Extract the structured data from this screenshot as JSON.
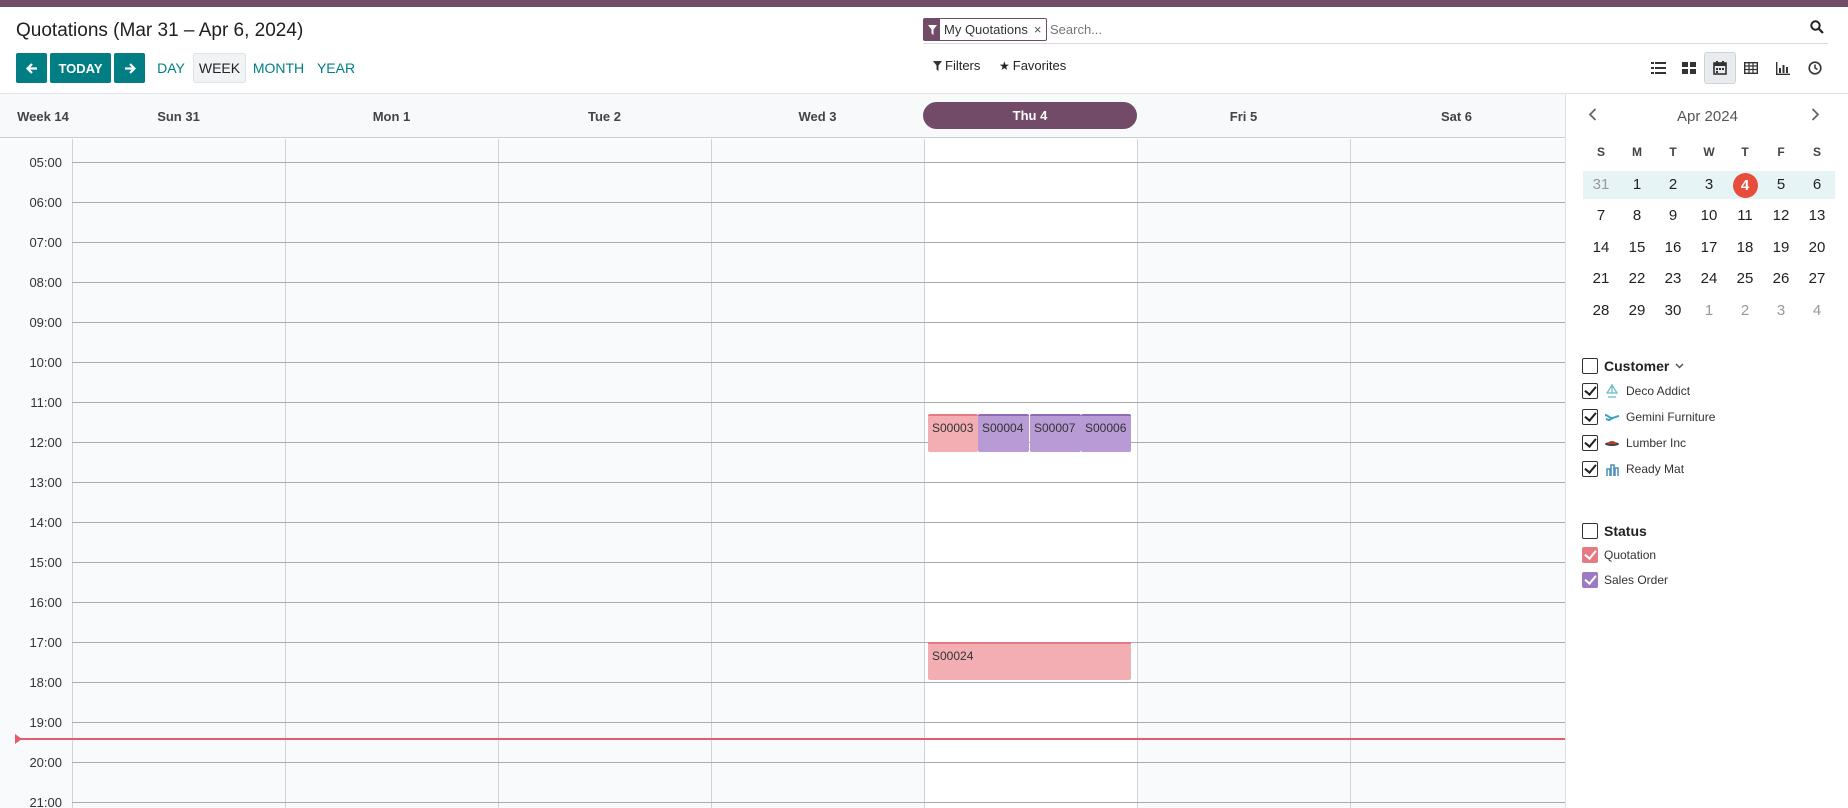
{
  "title": "Quotations (Mar 31 – Apr 6, 2024)",
  "search": {
    "facet_label": "My Quotations",
    "placeholder": "Search..."
  },
  "toolbar": {
    "prev": "←",
    "today": "TODAY",
    "next": "→",
    "scales": [
      "DAY",
      "WEEK",
      "MONTH",
      "YEAR"
    ],
    "active_scale": "WEEK",
    "filters": "Filters",
    "favorites": "Favorites"
  },
  "calendar": {
    "week_label": "Week 14",
    "days": [
      "Sun 31",
      "Mon 1",
      "Tue 2",
      "Wed 3",
      "Thu 4",
      "Fri 5",
      "Sat 6"
    ],
    "today_index": 4,
    "hours": [
      "05:00",
      "06:00",
      "07:00",
      "08:00",
      "09:00",
      "10:00",
      "11:00",
      "12:00",
      "13:00",
      "14:00",
      "15:00",
      "16:00",
      "17:00",
      "18:00",
      "19:00",
      "20:00",
      "21:00"
    ],
    "events": [
      {
        "name": "S00003",
        "status": "quotation"
      },
      {
        "name": "S00004",
        "status": "sales_order"
      },
      {
        "name": "S00007",
        "status": "sales_order"
      },
      {
        "name": "S00006",
        "status": "sales_order"
      },
      {
        "name": "S00024",
        "status": "quotation"
      }
    ]
  },
  "mini_calendar": {
    "title": "Apr 2024",
    "weekdays": [
      "S",
      "M",
      "T",
      "W",
      "T",
      "F",
      "S"
    ],
    "weeks": [
      [
        "31",
        "1",
        "2",
        "3",
        "4",
        "5",
        "6"
      ],
      [
        "7",
        "8",
        "9",
        "10",
        "11",
        "12",
        "13"
      ],
      [
        "14",
        "15",
        "16",
        "17",
        "18",
        "19",
        "20"
      ],
      [
        "21",
        "22",
        "23",
        "24",
        "25",
        "26",
        "27"
      ],
      [
        "28",
        "29",
        "30",
        "1",
        "2",
        "3",
        "4"
      ]
    ],
    "today": "4"
  },
  "filters_panel": {
    "customer": {
      "label": "Customer",
      "items": [
        "Deco Addict",
        "Gemini Furniture",
        "Lumber Inc",
        "Ready Mat"
      ]
    },
    "status": {
      "label": "Status",
      "items": [
        "Quotation",
        "Sales Order"
      ]
    }
  },
  "colors": {
    "brand": "#714b67",
    "teal": "#017e84",
    "quotation": "#f2aeb2",
    "sales_order": "#b89ad4",
    "now_line": "#e35d6a"
  }
}
